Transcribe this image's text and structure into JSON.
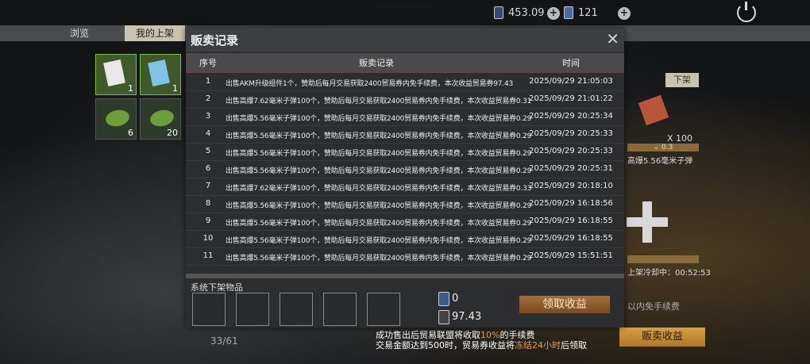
{
  "topbar": {
    "currency1_value": "453.09",
    "currency2_value": "121",
    "plus_label": "+"
  },
  "tabs": [
    {
      "label": "浏览"
    },
    {
      "label": "我的上架"
    }
  ],
  "inventory": {
    "slots": [
      {
        "count": "1"
      },
      {
        "count": "1"
      },
      {
        "count": "6"
      },
      {
        "count": "20"
      }
    ],
    "page_count": "33/61"
  },
  "right_panel": {
    "delist_button": "下架",
    "quantity": "X 100",
    "price": "⌄ 0.3",
    "item_name": "高爆5.56毫米子弹",
    "cooldown": "上架冷却中：00:52:53",
    "bg_text": "以内免手续费"
  },
  "notice": {
    "line1_pre": "成功售出后贸易联盟将收取",
    "line1_pct": "10%",
    "line1_post": "的手续费",
    "line2_pre": "交易金额达到500时，贸易券收益将",
    "line2_hl": "冻结24小时",
    "line2_post": "后领取"
  },
  "sell_income_button": "贩卖收益",
  "dialog": {
    "title": "贩卖记录",
    "close_label": "✕",
    "headers": {
      "no": "序号",
      "record": "贩卖记录",
      "time": "时间"
    },
    "rows": [
      {
        "no": "1",
        "record": "出售AKM升级组件1个，赞助后每月交易获取2400贸易券内免手续费，本次收益贸易券97.43",
        "time": "2025/09/29 21:05:03"
      },
      {
        "no": "2",
        "record": "出售高爆7.62毫米子弹100个，赞助后每月交易获取2400贸易券内免手续费，本次收益贸易券0.31",
        "time": "2025/09/29 21:01:22"
      },
      {
        "no": "3",
        "record": "出售高爆5.56毫米子弹100个，赞助后每月交易获取2400贸易券内免手续费，本次收益贸易券0.29",
        "time": "2025/09/29 20:25:34"
      },
      {
        "no": "4",
        "record": "出售高爆5.56毫米子弹100个，赞助后每月交易获取2400贸易券内免手续费，本次收益贸易券0.29",
        "time": "2025/09/29 20:25:33"
      },
      {
        "no": "5",
        "record": "出售高爆5.56毫米子弹100个，赞助后每月交易获取2400贸易券内免手续费，本次收益贸易券0.29",
        "time": "2025/09/29 20:25:33"
      },
      {
        "no": "6",
        "record": "出售高爆5.56毫米子弹100个，赞助后每月交易获取2400贸易券内免手续费，本次收益贸易券0.29",
        "time": "2025/09/29 20:25:31"
      },
      {
        "no": "7",
        "record": "出售高爆7.62毫米子弹100个，赞助后每月交易获取2400贸易券内免手续费，本次收益贸易券0.33",
        "time": "2025/09/29 20:18:10"
      },
      {
        "no": "8",
        "record": "出售高爆5.56毫米子弹100个，赞助后每月交易获取2400贸易券内免手续费，本次收益贸易券0.29",
        "time": "2025/09/29 16:18:56"
      },
      {
        "no": "9",
        "record": "出售高爆5.56毫米子弹100个，赞助后每月交易获取2400贸易券内免手续费，本次收益贸易券0.29",
        "time": "2025/09/29 16:18:55"
      },
      {
        "no": "10",
        "record": "出售高爆5.56毫米子弹100个，赞助后每月交易获取2400贸易券内免手续费，本次收益贸易券0.29",
        "time": "2025/09/29 16:18:55"
      },
      {
        "no": "11",
        "record": "出售高爆5.56毫米子弹100个，赞助后每月交易获取2400贸易券内免手续费，本次收益贸易券0.29",
        "time": "2025/09/29 15:51:51"
      }
    ],
    "system_delisted_label": "系统下架物品",
    "summary": {
      "currency1": "0",
      "currency2": "97.43"
    },
    "claim_button": "领取收益"
  }
}
